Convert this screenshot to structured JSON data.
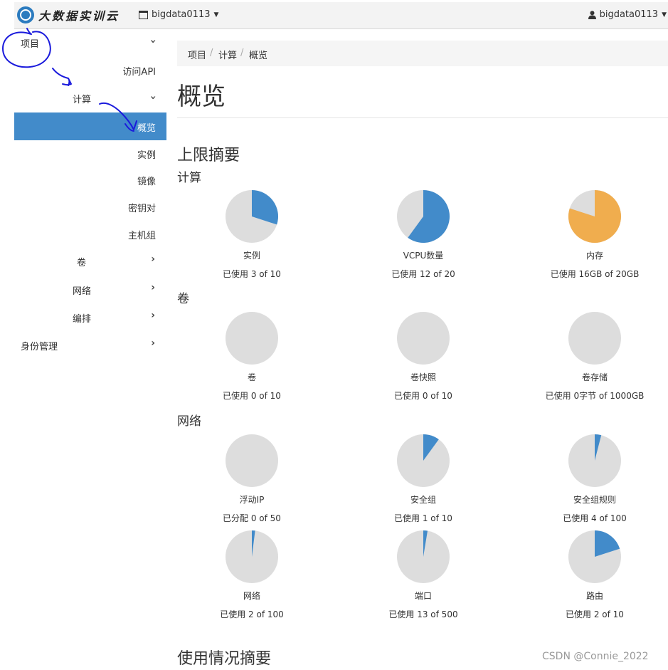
{
  "header": {
    "brand": "大数据实训云",
    "project": "bigdata0113",
    "user": "bigdata0113"
  },
  "sidebar": {
    "project": "项目",
    "api_access": "访问API",
    "compute": "计算",
    "overview": "概览",
    "instances": "实例",
    "images": "镜像",
    "keypairs": "密钥对",
    "host_groups": "主机组",
    "volumes": "卷",
    "network": "网络",
    "orchestration": "编排",
    "identity": "身份管理"
  },
  "breadcrumb": [
    "项目",
    "计算",
    "概览"
  ],
  "page_title": "概览",
  "limit_summary": "上限摘要",
  "sections": {
    "compute": "计算",
    "volumes": "卷",
    "network": "网络"
  },
  "colors": {
    "used": "#428bca",
    "warn": "#f0ad4e",
    "free": "#dddddd",
    "active_nav": "#428bca"
  },
  "quotas": [
    {
      "label": "实例",
      "usage": "已使用 3 of 10",
      "fraction": 0.3,
      "color": "#428bca"
    },
    {
      "label": "VCPU数量",
      "usage": "已使用 12 of 20",
      "fraction": 0.6,
      "color": "#428bca"
    },
    {
      "label": "内存",
      "usage": "已使用 16GB of 20GB",
      "fraction": 0.8,
      "color": "#f0ad4e"
    },
    {
      "label": "卷",
      "usage": "已使用 0 of 10",
      "fraction": 0,
      "color": "#428bca"
    },
    {
      "label": "卷快照",
      "usage": "已使用 0 of 10",
      "fraction": 0,
      "color": "#428bca"
    },
    {
      "label": "卷存储",
      "usage": "已使用 0字节 of 1000GB",
      "fraction": 0,
      "color": "#428bca"
    },
    {
      "label": "浮动IP",
      "usage": "已分配 0 of 50",
      "fraction": 0,
      "color": "#428bca"
    },
    {
      "label": "安全组",
      "usage": "已使用 1 of 10",
      "fraction": 0.1,
      "color": "#428bca"
    },
    {
      "label": "安全组规则",
      "usage": "已使用 4 of 100",
      "fraction": 0.04,
      "color": "#428bca"
    },
    {
      "label": "网络",
      "usage": "已使用 2 of 100",
      "fraction": 0.02,
      "color": "#428bca"
    },
    {
      "label": "端口",
      "usage": "已使用 13 of 500",
      "fraction": 0.026,
      "color": "#428bca"
    },
    {
      "label": "路由",
      "usage": "已使用 2 of 10",
      "fraction": 0.2,
      "color": "#428bca"
    }
  ],
  "usage_summary": "使用情况摘要",
  "watermark": "CSDN @Connie_2022"
}
